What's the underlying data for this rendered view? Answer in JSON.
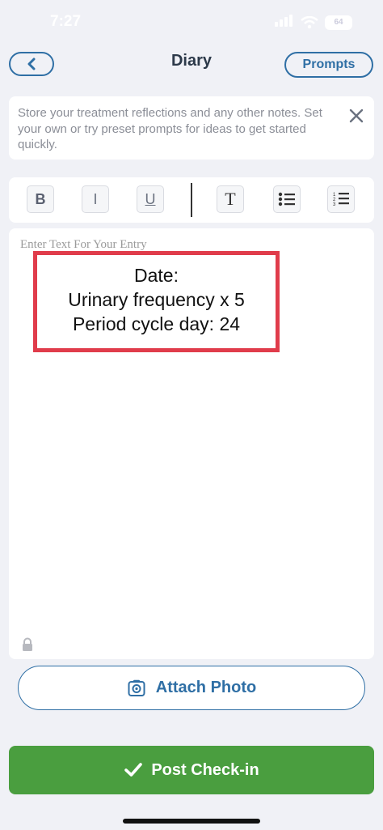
{
  "status_bar": {
    "time": "7:27",
    "battery": "64"
  },
  "header": {
    "title": "Diary",
    "prompts_label": "Prompts"
  },
  "info_card": {
    "text": "Store your treatment reflections and any other notes. Set your own or try preset prompts for ideas to get started quickly."
  },
  "toolbar": {
    "bold": "B",
    "italic": "I",
    "underline": "U",
    "text_size": "T"
  },
  "editor": {
    "placeholder": "Enter Text For Your Entry",
    "annotation_lines": [
      "Date:",
      "Urinary frequency x 5",
      "Period cycle day: 24"
    ]
  },
  "attach": {
    "label": "Attach Photo"
  },
  "post": {
    "label": "Post Check-in"
  },
  "colors": {
    "accent": "#2f6fa5",
    "green": "#4a9e3f",
    "annotation": "#e03c4b"
  },
  "icons": [
    "chevron-left-icon",
    "close-icon",
    "bullet-list-icon",
    "numbered-list-icon",
    "lock-icon",
    "camera-icon",
    "checkmark-icon"
  ]
}
